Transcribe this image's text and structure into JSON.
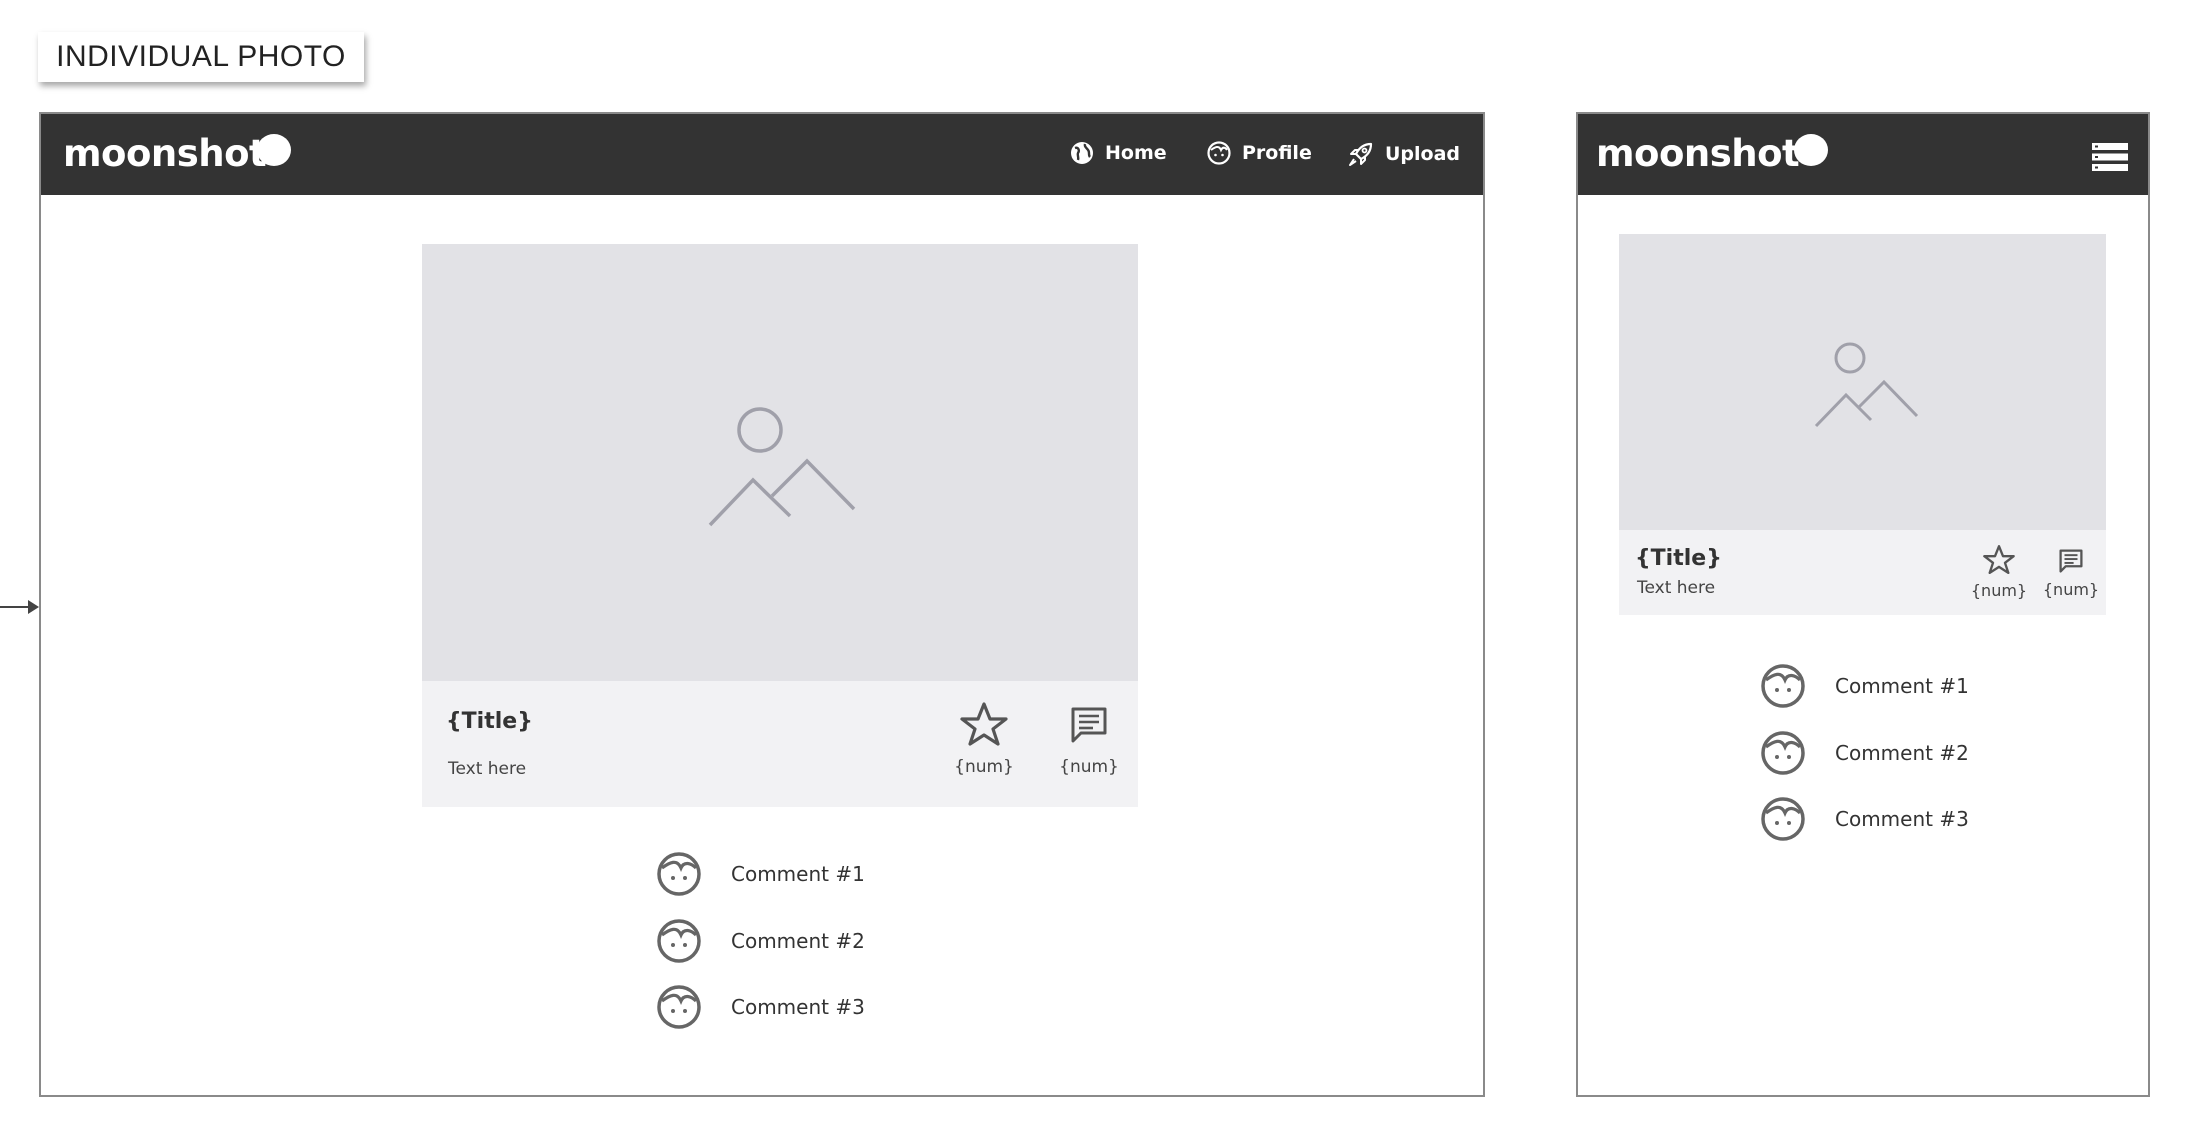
{
  "annotation": {
    "label": "INDIVIDUAL PHOTO"
  },
  "desktop": {
    "brand": "moonshot",
    "nav": [
      {
        "label": "Home",
        "icon": "globe-icon"
      },
      {
        "label": "Profile",
        "icon": "face-icon"
      },
      {
        "label": "Upload",
        "icon": "rocket-icon"
      }
    ],
    "card": {
      "image_icon": "image-placeholder-icon",
      "title": "{Title}",
      "text": "Text here",
      "stars": "{num}",
      "comments": "{num}"
    },
    "comments": [
      {
        "text": "Comment #1",
        "icon": "user-avatar-icon"
      },
      {
        "text": "Comment #2",
        "icon": "user-avatar-icon"
      },
      {
        "text": "Comment #3",
        "icon": "user-avatar-icon"
      }
    ]
  },
  "mobile": {
    "brand": "moonshot",
    "menu_icon": "hamburger-menu-icon",
    "card": {
      "image_icon": "image-placeholder-icon",
      "title": "{Title}",
      "text": "Text here",
      "stars": "{num}",
      "comments": "{num}"
    },
    "comments": [
      {
        "text": "Comment #1",
        "icon": "user-avatar-icon"
      },
      {
        "text": "Comment #2",
        "icon": "user-avatar-icon"
      },
      {
        "text": "Comment #3",
        "icon": "user-avatar-icon"
      }
    ]
  },
  "colors": {
    "navbar": "#333333",
    "image_placeholder": "#e2e2e6",
    "card_footer": "#f2f2f4",
    "icon_gray": "#666666"
  }
}
